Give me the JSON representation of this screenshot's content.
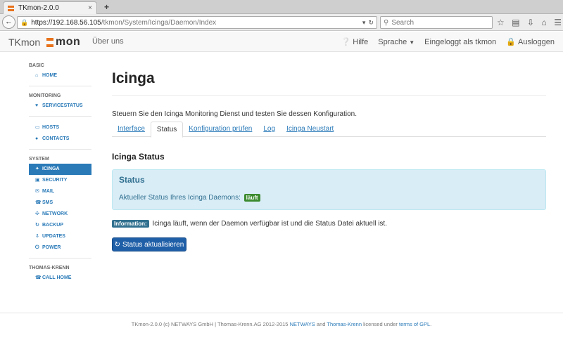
{
  "browser": {
    "tab_title": "TKmon-2.0.0",
    "tab_close": "×",
    "new_tab": "+",
    "url_host": "https://192.168.56.105",
    "url_path": "/tkmon/System/Icinga/Daemon/Index",
    "search_placeholder": "Search"
  },
  "header": {
    "brand": "TKmon",
    "logo_text": "mon",
    "about": "Über uns",
    "help": "Hilfe",
    "language": "Sprache",
    "logged_in": "Eingeloggt als tkmon",
    "logout": "Ausloggen"
  },
  "sidebar": {
    "basic_header": "BASIC",
    "home": "HOME",
    "monitoring_header": "MONITORING",
    "servicestatus": "SERVICESTATUS",
    "hosts": "HOSTS",
    "contacts": "CONTACTS",
    "system_header": "SYSTEM",
    "icinga": "ICINGA",
    "security": "SECURITY",
    "mail": "MAIL",
    "sms": "SMS",
    "network": "NETWORK",
    "backup": "BACKUP",
    "updates": "UPDATES",
    "power": "POWER",
    "tk_header": "THOMAS-KRENN",
    "call_home": "CALL HOME"
  },
  "main": {
    "title": "Icinga",
    "intro": "Steuern Sie den Icinga Monitoring Dienst und testen Sie dessen Konfiguration.",
    "tabs": {
      "interface": "Interface",
      "status": "Status",
      "config_check": "Konfiguration prüfen",
      "log": "Log",
      "restart": "Icinga Neustart"
    },
    "section_title": "Icinga Status",
    "status_box_title": "Status",
    "status_text": "Aktueller Status Ihres Icinga Daemons:",
    "status_badge": "läuft",
    "info_badge": "Information:",
    "info_text": "Icinga läuft, wenn der Daemon verfügbar ist und die Status Datei aktuell ist.",
    "refresh_button": "Status aktualisieren"
  },
  "footer": {
    "prefix": "TKmon-2.0.0 (c) NETWAYS GmbH | Thomas-Krenn.AG 2012-2015",
    "netways": "NETWAYS",
    "and": "and",
    "tk": "Thomas-Krenn",
    "licensed": "licensed under",
    "gpl": "terms of GPL",
    "dot": "."
  },
  "colors": {
    "accent": "#2a7ab8",
    "brand_orange": "#e8711b",
    "success": "#3c8b2f",
    "info_bg": "#d9edf7"
  }
}
